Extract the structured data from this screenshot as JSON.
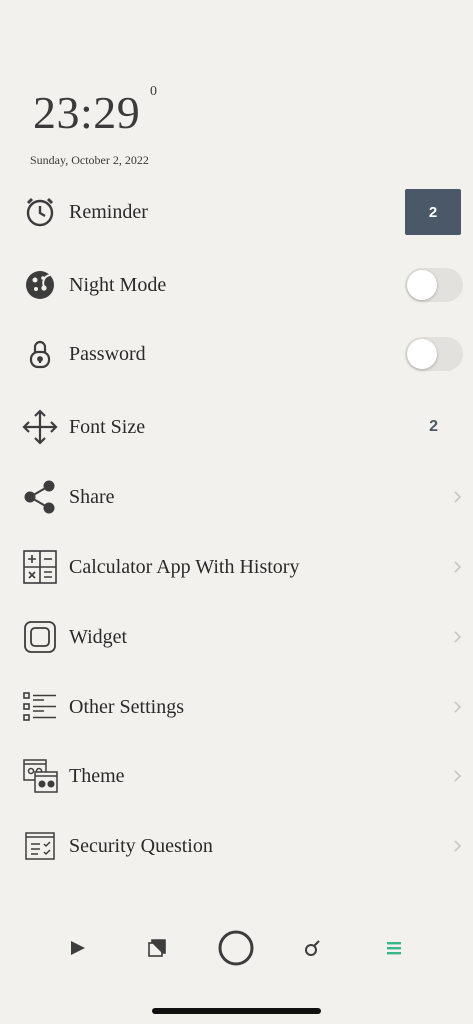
{
  "header": {
    "time": "23:29",
    "time_superscript": "0",
    "date": "Sunday, October 2, 2022"
  },
  "settings": {
    "reminder": {
      "label": "Reminder",
      "badge": "2",
      "icon": "alarm-clock-icon"
    },
    "night_mode": {
      "label": "Night Mode",
      "enabled": false,
      "icon": "moon-cookie-icon"
    },
    "password": {
      "label": "Password",
      "enabled": false,
      "icon": "lock-icon"
    },
    "font_size": {
      "label": "Font Size",
      "value": "2",
      "icon": "move-arrows-icon"
    },
    "share": {
      "label": "Share",
      "icon": "share-icon"
    },
    "calculator": {
      "label": "Calculator App With History",
      "icon": "calculator-icon"
    },
    "widget": {
      "label": "Widget",
      "icon": "widget-icon"
    },
    "other_settings": {
      "label": "Other Settings",
      "icon": "list-settings-icon"
    },
    "theme": {
      "label": "Theme",
      "icon": "theme-icon"
    },
    "security_question": {
      "label": "Security Question",
      "icon": "security-checklist-icon"
    }
  },
  "bottom_nav": {
    "items": [
      "play-icon",
      "copy-icon",
      "circle-icon",
      "key-icon",
      "menu-icon"
    ],
    "active": "menu-icon"
  },
  "colors": {
    "background": "#f3f1ed",
    "badge": "#4b5868",
    "accent": "#3bb58a",
    "toggle_off": "#e2e1dd"
  }
}
